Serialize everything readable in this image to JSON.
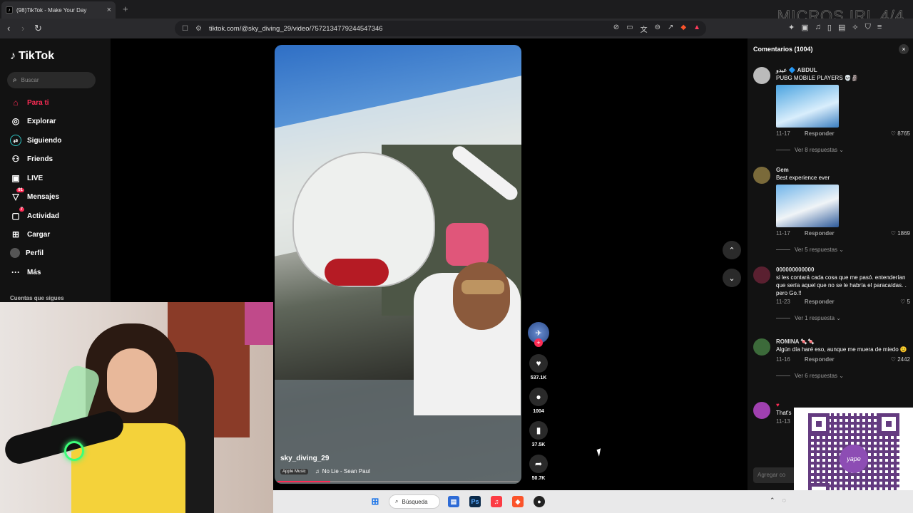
{
  "browser": {
    "tab_title": "(98)TikTok - Make Your Day",
    "url": "tiktok.com/@sky_diving_29/video/7572134779244547346",
    "overlay_text": "MICROS IRL 4/4"
  },
  "sidebar": {
    "logo": "TikTok",
    "search_placeholder": "Buscar",
    "items": [
      {
        "label": "Para ti",
        "icon": "home-icon",
        "badge": ""
      },
      {
        "label": "Explorar",
        "icon": "compass-icon",
        "badge": ""
      },
      {
        "label": "Siguiendo",
        "icon": "following-icon",
        "badge": ""
      },
      {
        "label": "Friends",
        "icon": "friends-icon",
        "badge": ""
      },
      {
        "label": "LIVE",
        "icon": "live-icon",
        "badge": ""
      },
      {
        "label": "Mensajes",
        "icon": "messages-icon",
        "badge": "91"
      },
      {
        "label": "Actividad",
        "icon": "activity-icon",
        "badge": "7"
      },
      {
        "label": "Cargar",
        "icon": "upload-icon",
        "badge": ""
      },
      {
        "label": "Perfil",
        "icon": "profile-icon",
        "badge": ""
      },
      {
        "label": "Más",
        "icon": "more-icon",
        "badge": ""
      }
    ],
    "following_label": "Cuentas que sigues"
  },
  "video": {
    "username": "sky_diving_29",
    "music_badge": "Apple Music",
    "music": "No Lie - Sean Paul",
    "progress": 0.22
  },
  "actions": {
    "likes": "537.1K",
    "comments": "1004",
    "saves": "37.5K",
    "shares": "50.7K"
  },
  "comments_panel": {
    "title": "Comentarios (1004)",
    "input_placeholder": "Agregar co",
    "comments": [
      {
        "name": "عبدو 🔷 ABDUL",
        "text": "PUBG MOBILE PLAYERS 💀🗿",
        "date": "11-17",
        "reply": "Responder",
        "likes": "8765",
        "replies": "Ver 8 respuestas"
      },
      {
        "name": "Gem",
        "text": "Best experience ever",
        "date": "11-17",
        "reply": "Responder",
        "likes": "1869",
        "replies": "Ver 5 respuestas"
      },
      {
        "name": "000000000000",
        "text": "si les contará cada cosa que me pasó. entenderían que sería aquel que no se le habría el paracaídas. . pero Go.!!",
        "date": "11-23",
        "reply": "Responder",
        "likes": "5",
        "replies": "Ver 1 respuesta"
      },
      {
        "name": "ROMINA 🍬🍬",
        "text": "Algún día haré eso, aunque me muera de miedo 😉",
        "date": "11-16",
        "reply": "Responder",
        "likes": "2442",
        "replies": "Ver 6 respuestas"
      },
      {
        "name": "♥",
        "text": "That's",
        "date": "11-13",
        "reply": "",
        "likes": "",
        "replies": ""
      }
    ]
  },
  "qr": {
    "brand": "yape"
  },
  "taskbar": {
    "search_label": "Búsqueda"
  },
  "colors": {
    "accent": "#fe2c55",
    "panel": "#121212"
  }
}
